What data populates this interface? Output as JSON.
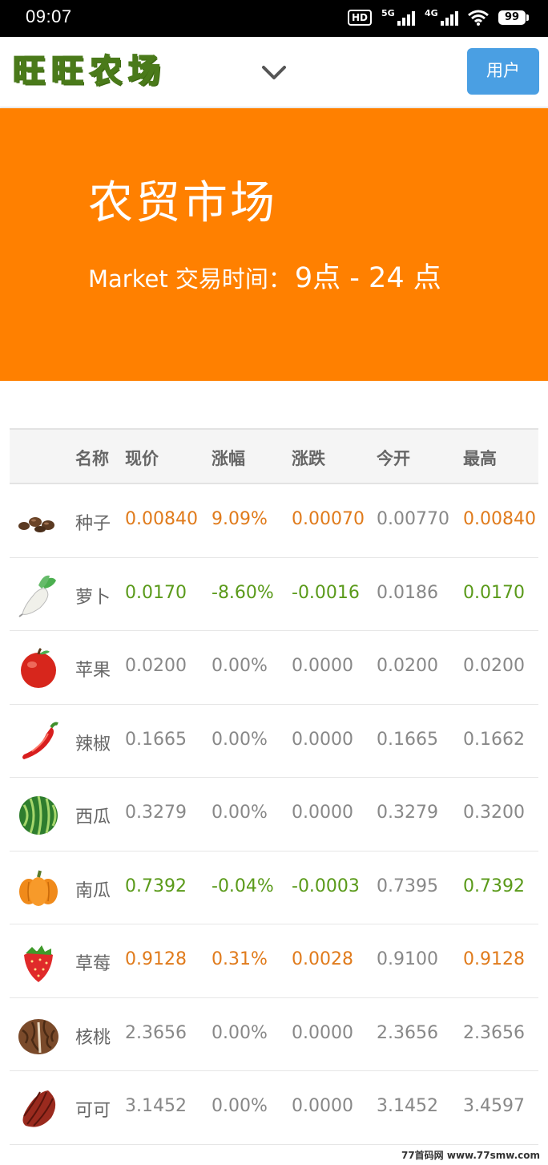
{
  "status": {
    "time": "09:07",
    "hd": "HD",
    "net1": "5G",
    "net2": "4G",
    "battery": "99"
  },
  "nav": {
    "logo_chars": [
      "旺",
      "旺",
      "农",
      "场"
    ],
    "user_label": "用户"
  },
  "hero": {
    "title": "农贸市场",
    "subtitle_prefix": "Market 交易时间：",
    "subtitle_time": "9点 - 24 点"
  },
  "table": {
    "headers": [
      "名称",
      "现价",
      "涨幅",
      "涨跌",
      "今开",
      "最高"
    ],
    "rows": [
      {
        "icon": "seeds-icon",
        "name": "种子",
        "price": "0.00840",
        "pct": "9.09%",
        "chg": "0.00070",
        "open": "0.00770",
        "high": "0.00840",
        "trend": "up"
      },
      {
        "icon": "radish-icon",
        "name": "萝卜",
        "price": "0.0170",
        "pct": "-8.60%",
        "chg": "-0.0016",
        "open": "0.0186",
        "high": "0.0170",
        "trend": "down"
      },
      {
        "icon": "apple-icon",
        "name": "苹果",
        "price": "0.0200",
        "pct": "0.00%",
        "chg": "0.0000",
        "open": "0.0200",
        "high": "0.0200",
        "trend": "flat"
      },
      {
        "icon": "chili-icon",
        "name": "辣椒",
        "price": "0.1665",
        "pct": "0.00%",
        "chg": "0.0000",
        "open": "0.1665",
        "high": "0.1662",
        "trend": "flat"
      },
      {
        "icon": "watermelon-icon",
        "name": "西瓜",
        "price": "0.3279",
        "pct": "0.00%",
        "chg": "0.0000",
        "open": "0.3279",
        "high": "0.3200",
        "trend": "flat"
      },
      {
        "icon": "pumpkin-icon",
        "name": "南瓜",
        "price": "0.7392",
        "pct": "-0.04%",
        "chg": "-0.0003",
        "open": "0.7395",
        "high": "0.7392",
        "trend": "down"
      },
      {
        "icon": "strawberry-icon",
        "name": "草莓",
        "price": "0.9128",
        "pct": "0.31%",
        "chg": "0.0028",
        "open": "0.9100",
        "high": "0.9128",
        "trend": "up"
      },
      {
        "icon": "walnut-icon",
        "name": "核桃",
        "price": "2.3656",
        "pct": "0.00%",
        "chg": "0.0000",
        "open": "2.3656",
        "high": "2.3656",
        "trend": "flat"
      },
      {
        "icon": "cocoa-icon",
        "name": "可可",
        "price": "3.1452",
        "pct": "0.00%",
        "chg": "0.0000",
        "open": "3.1452",
        "high": "3.4597",
        "trend": "flat"
      }
    ]
  },
  "colors": {
    "hero_bg": "#ff8000",
    "user_button": "#4a9fe3",
    "up": "#e07b1c",
    "down": "#5a9a1a",
    "flat": "#888888"
  },
  "watermark": "77首码网  www.77smw.com"
}
